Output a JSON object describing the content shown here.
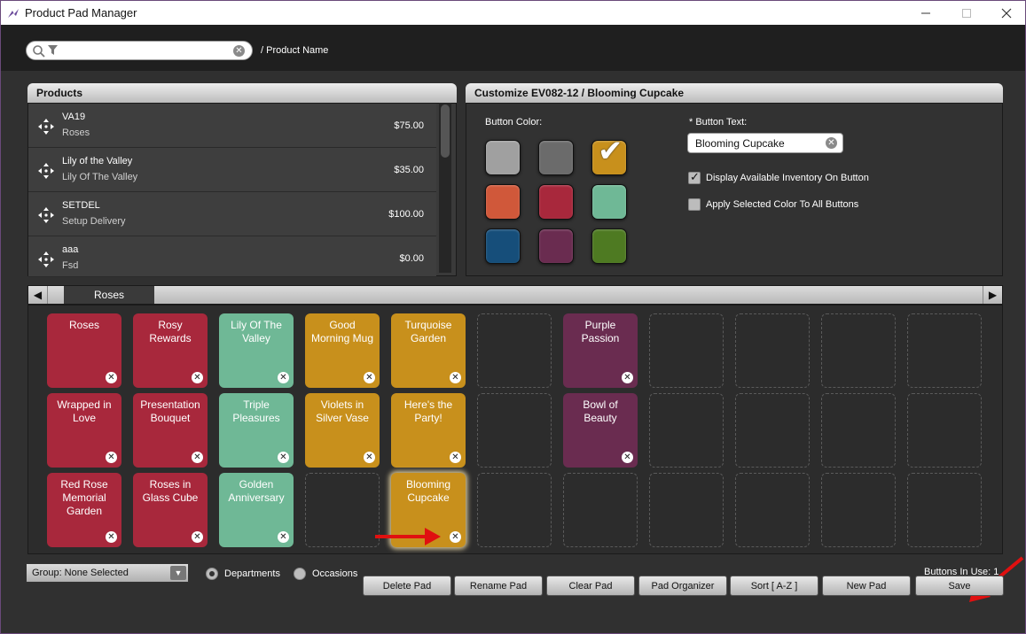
{
  "window": {
    "title": "Product Pad Manager"
  },
  "search": {
    "value": "",
    "label": "/ Product Name"
  },
  "products_panel": {
    "title": "Products",
    "items": [
      {
        "code": "VA19",
        "name": "Roses",
        "price": "$75.00"
      },
      {
        "code": "Lily of the Valley",
        "name": "Lily Of The Valley",
        "price": "$35.00"
      },
      {
        "code": "SETDEL",
        "name": "Setup Delivery",
        "price": "$100.00"
      },
      {
        "code": "aaa",
        "name": "Fsd",
        "price": "$0.00"
      }
    ]
  },
  "customize_panel": {
    "title": "Customize EV082-12 / Blooming Cupcake",
    "button_color_label": "Button Color:",
    "swatches": [
      "#a0a0a0",
      "#6b6b6b",
      "#c8901c",
      "#d0583a",
      "#a8283c",
      "#6fb896",
      "#164e7a",
      "#6a2c50",
      "#4e7a22"
    ],
    "selected_swatch": 2,
    "button_text_label": "* Button Text:",
    "button_text_value": "Blooming Cupcake",
    "display_inventory_label": "Display Available Inventory On Button",
    "display_inventory_checked": true,
    "apply_color_label": "Apply Selected Color To All Buttons",
    "apply_color_checked": false
  },
  "pad_tab": {
    "label": "Roses"
  },
  "pad_buttons": [
    {
      "label": "Roses",
      "color": "#a8283c"
    },
    {
      "label": "Rosy Rewards",
      "color": "#a8283c"
    },
    {
      "label": "Lily Of The Valley",
      "color": "#6fb896"
    },
    {
      "label": "Good Morning Mug",
      "color": "#c8901c"
    },
    {
      "label": "Turquoise Garden",
      "color": "#c8901c"
    },
    {
      "label": "Purple Passion",
      "color": "#6a2c50"
    },
    {
      "label": "Wrapped in Love",
      "color": "#a8283c"
    },
    {
      "label": "Presentation Bouquet",
      "color": "#a8283c"
    },
    {
      "label": "Triple Pleasures",
      "color": "#6fb896"
    },
    {
      "label": "Violets in Silver Vase",
      "color": "#c8901c"
    },
    {
      "label": "Here's the Party!",
      "color": "#c8901c"
    },
    {
      "label": "Bowl of Beauty",
      "color": "#6a2c50"
    },
    {
      "label": "Red Rose Memorial Garden",
      "color": "#a8283c"
    },
    {
      "label": "Roses in Glass Cube",
      "color": "#a8283c"
    },
    {
      "label": "Golden Anniversary",
      "color": "#6fb896"
    },
    {
      "label": "Blooming Cupcake",
      "color": "#c8901c"
    }
  ],
  "footer": {
    "group_select": "Group: None Selected",
    "radio_departments": "Departments",
    "radio_occasions": "Occasions",
    "buttons_in_use": "Buttons In Use: 1"
  },
  "actions": {
    "delete_pad": "Delete Pad",
    "rename_pad": "Rename Pad",
    "clear_pad": "Clear Pad",
    "pad_organizer": "Pad Organizer",
    "sort": "Sort [ A-Z ]",
    "new_pad": "New Pad",
    "save": "Save"
  }
}
